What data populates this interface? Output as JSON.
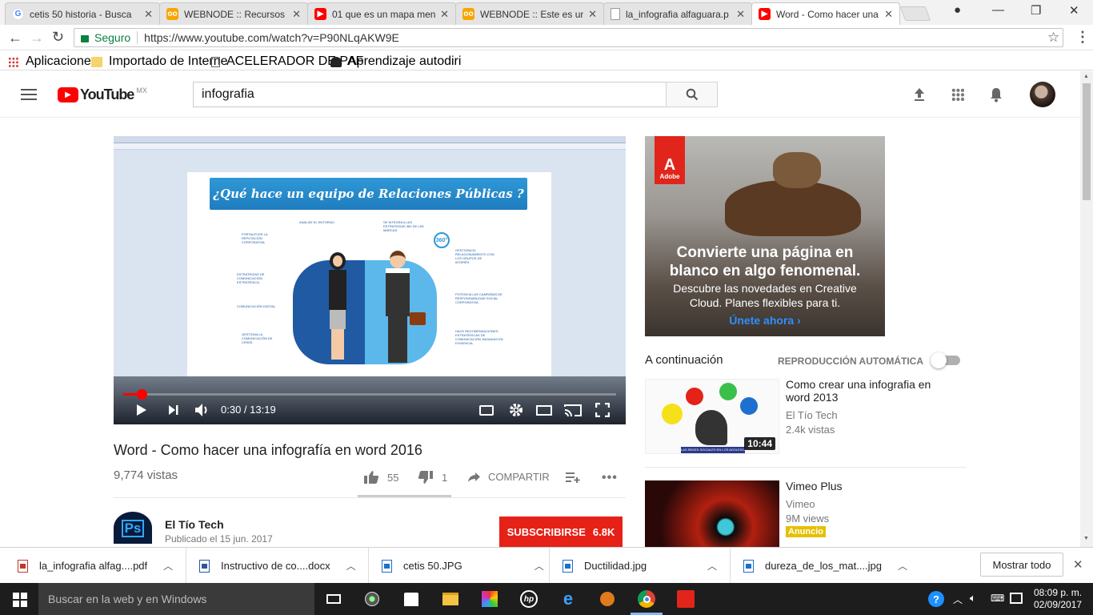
{
  "browser": {
    "tabs": [
      {
        "title": "cetis 50 historia - Busca",
        "icon": "google-icon",
        "active": false
      },
      {
        "title": "WEBNODE :: Recursos g",
        "icon": "webnode-icon",
        "active": false
      },
      {
        "title": "01 que es un mapa men",
        "icon": "youtube-icon",
        "active": false
      },
      {
        "title": "WEBNODE :: Este es un",
        "icon": "webnode-icon",
        "active": false
      },
      {
        "title": "la_infografia alfaguara.p",
        "icon": "document-icon",
        "active": false
      },
      {
        "title": "Word - Como hacer una",
        "icon": "youtube-icon",
        "active": true
      }
    ],
    "secure_label": "Seguro",
    "url": "https://www.youtube.com/watch?v=P90NLqAKW9E",
    "bookmarks": [
      {
        "label": "Aplicaciones",
        "icon": "apps-grid-icon"
      },
      {
        "label": "Importado de Interne",
        "icon": "folder-icon"
      },
      {
        "label": "ACELERADOR DE PAF",
        "icon": "page-icon"
      },
      {
        "label": "Aprendizaje autodiri",
        "icon": "graduation-icon"
      }
    ]
  },
  "youtube": {
    "logo_text": "YouTube",
    "region": "MX",
    "search_query": "infografia"
  },
  "video": {
    "slide_title": "¿Qué hace un equipo de Relaciones Públicas ?",
    "slide_labels": [
      "FORTALECER LA REPUTACIÓN CORPORATIVA.",
      "ESTRATEGIAS DE COMUNICACIÓN ESTRATÉGICA.",
      "COMUNICACIÓN DIGITAL.",
      "GESTIONA LA COMUNICACIÓN DE CRISIS.",
      "ANALIZE EL ENTORNO.",
      "SE INTEGRA A LAS ESTRATEGIAS 360 DE LAS MARCAS.",
      "GESTIONA EL RELACIONAMIENTO CON LOS GRUPOS DE INTERÉS.",
      "POTENCIA LAS CAMPAÑAS DE RESPONSABILIDAD SOCIAL CORPORATIVA.",
      "HACE RECOMENDACIONES ESTRATÉGICAS DE COMUNICACIÓN, BASADAS EN EVIDENCIA."
    ],
    "slide_badge": "360°",
    "time_display": "0:30 / 13:19",
    "progress_fraction": 0.038,
    "title": "Word - Como hacer una infografía en word 2016",
    "views": "9,774 vistas",
    "likes": "55",
    "dislikes": "1",
    "share_label": "COMPARTIR",
    "channel_name": "El Tío Tech",
    "channel_avatar_text": "Ps",
    "published": "Publicado el 15 jun. 2017",
    "subscribe_label": "SUBSCRIBIRSE",
    "subscriber_count": "6.8K"
  },
  "ad": {
    "brand": "Adobe",
    "headline": "Convierte una página en blanco en algo fenomenal.",
    "body": "Descubre las novedades en Creative Cloud. Planes flexibles para ti.",
    "cta": "Únete ahora ›"
  },
  "sidebar": {
    "up_next_label": "A continuación",
    "autoplay_label": "REPRODUCCIÓN AUTOMÁTICA",
    "autoplay_on": false,
    "items": [
      {
        "title": "Como crear una infografia en word 2013",
        "channel": "El Tío Tech",
        "meta": "2.4k vistas",
        "duration": "10:44",
        "thumb_caption": "LAS REDES SOCIALES EN LOS ADOLESCENTES"
      },
      {
        "title": "Vimeo Plus",
        "channel": "Vimeo",
        "meta": "9M views",
        "badge": "Anuncio"
      }
    ]
  },
  "downloads": {
    "items": [
      {
        "name": "la_infografia alfag....pdf",
        "icon": "pdf-icon"
      },
      {
        "name": "Instructivo de co....docx",
        "icon": "word-icon"
      },
      {
        "name": "cetis 50.JPG",
        "icon": "image-icon"
      },
      {
        "name": "Ductilidad.jpg",
        "icon": "image-icon"
      },
      {
        "name": "dureza_de_los_mat....jpg",
        "icon": "image-icon"
      }
    ],
    "show_all_label": "Mostrar todo"
  },
  "taskbar": {
    "search_placeholder": "Buscar en la web y en Windows",
    "time": "08:09 p. m.",
    "date": "02/09/2017"
  },
  "colors": {
    "youtube_red": "#ff0000",
    "subscribe_red": "#e62117",
    "adobe_red": "#e1251b",
    "ad_link_blue": "#2f8fff",
    "taskbar": "#1d1d1d",
    "badge_yellow": "#e6c000"
  }
}
